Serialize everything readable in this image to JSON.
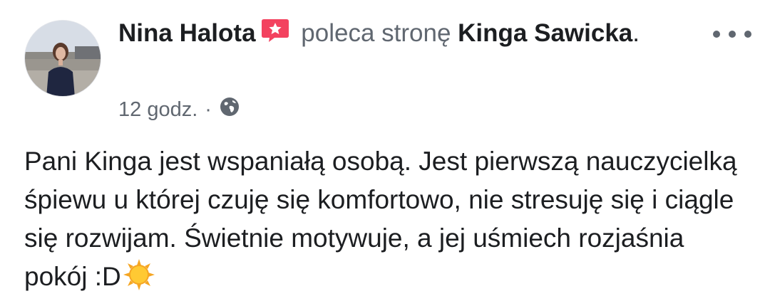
{
  "post": {
    "author_name": "Nina Halota",
    "action_text": "poleca stronę",
    "page_name": "Kinga Sawicka",
    "period": ".",
    "timestamp": "12 godz.",
    "separator": "·",
    "privacy_icon": "globe-icon",
    "recommend_icon": "recommendation-star-icon",
    "menu_icon": "more-options-icon",
    "body": "Pani Kinga jest wspaniałą osobą. Jest pierwszą nauczycielką śpiewu u której czuję się komfortowo, nie stresuję się i ciągle się rozwijam. Świetnie motywuje, a jej uśmiech rozjaśnia pokój :D",
    "emoji_icon": "sun-emoji-icon"
  },
  "colors": {
    "text_primary": "#1c1e21",
    "text_secondary": "#606770",
    "recommend_badge": "#f3425f"
  }
}
